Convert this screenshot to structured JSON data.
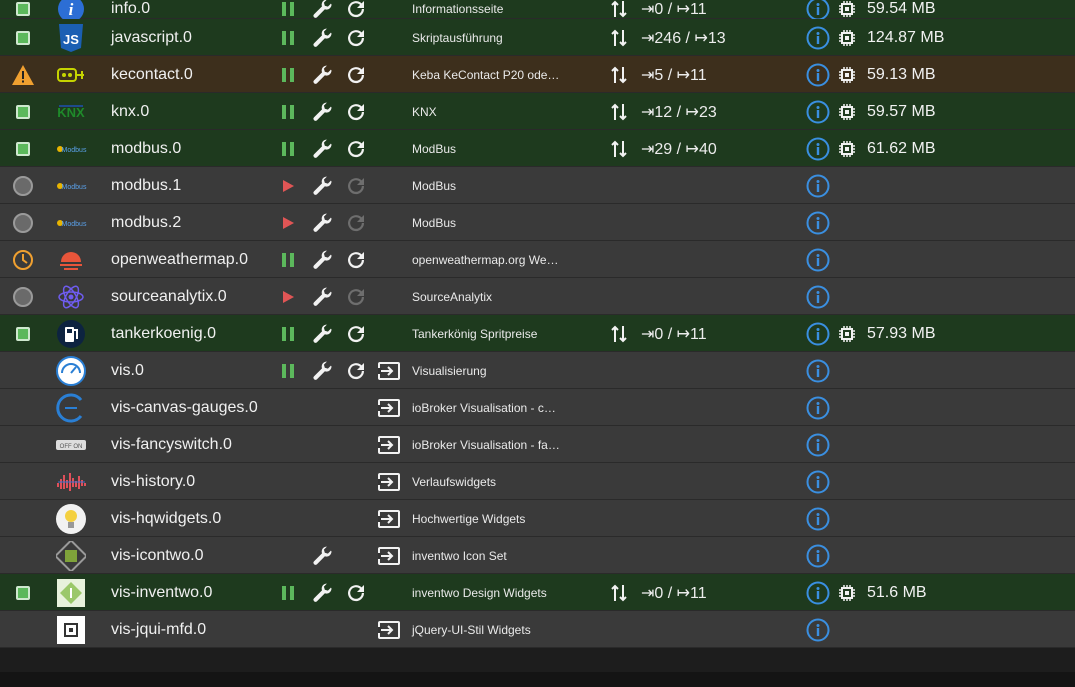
{
  "colors": {
    "running_row": "#1e3a1e",
    "warning_row": "#3d2f1c",
    "stopped_row": "#3a3a3a",
    "status_green": "#5cb85c",
    "run_green": "#5cb85c",
    "play_red": "#e05555",
    "info_blue": "#3a8fe0",
    "warning_orange": "#f0a030"
  },
  "adapters": [
    {
      "name": "info.0",
      "title": "Informationsseite",
      "state": "running",
      "status": "green-square",
      "logo": "info-logo-icon",
      "events": "⇥0 / ↦11",
      "memory": "59.54 MB",
      "link": false
    },
    {
      "name": "javascript.0",
      "title": "Skriptausführung",
      "state": "running",
      "status": "green-square",
      "logo": "javascript-logo-icon",
      "logo_text": "JS",
      "events": "⇥246 / ↦13",
      "memory": "124.87 MB",
      "link": false
    },
    {
      "name": "kecontact.0",
      "title": "Keba KeContact P20 ode…",
      "state": "warning",
      "status": "warning-triangle",
      "logo": "kecontact-logo-icon",
      "events": "⇥5 / ↦11",
      "memory": "59.13 MB",
      "link": false
    },
    {
      "name": "knx.0",
      "title": "KNX",
      "state": "running",
      "status": "green-square",
      "logo": "knx-logo-icon",
      "logo_text": "KNX",
      "events": "⇥12 / ↦23",
      "memory": "59.57 MB",
      "link": false
    },
    {
      "name": "modbus.0",
      "title": "ModBus",
      "state": "running",
      "status": "green-square",
      "logo": "modbus-logo-icon",
      "logo_text": "Modbus",
      "events": "⇥29 / ↦40",
      "memory": "61.62 MB",
      "link": false
    },
    {
      "name": "modbus.1",
      "title": "ModBus",
      "state": "stopped",
      "status": "grey-circle",
      "logo": "modbus-logo-icon",
      "logo_text": "Modbus",
      "events": "",
      "memory": "",
      "link": false
    },
    {
      "name": "modbus.2",
      "title": "ModBus",
      "state": "stopped",
      "status": "grey-circle",
      "logo": "modbus-logo-icon",
      "logo_text": "Modbus",
      "events": "",
      "memory": "",
      "link": false
    },
    {
      "name": "openweathermap.0",
      "title": "openweathermap.org We…",
      "state": "scheduled",
      "status": "clock",
      "logo": "openweathermap-logo-icon",
      "events": "",
      "memory": "",
      "link": false
    },
    {
      "name": "sourceanalytix.0",
      "title": "SourceAnalytix",
      "state": "stopped",
      "status": "grey-circle",
      "logo": "sourceanalytix-logo-icon",
      "events": "",
      "memory": "",
      "link": false
    },
    {
      "name": "tankerkoenig.0",
      "title": "Tankerkönig Spritpreise",
      "state": "running",
      "status": "green-square",
      "logo": "tankerkoenig-logo-icon",
      "events": "⇥0 / ↦11",
      "memory": "57.93 MB",
      "link": false
    },
    {
      "name": "vis.0",
      "title": "Visualisierung",
      "state": "none-running",
      "status": "none",
      "logo": "vis-logo-icon",
      "events": "",
      "memory": "",
      "link": true
    },
    {
      "name": "vis-canvas-gauges.0",
      "title": "ioBroker Visualisation - c…",
      "state": "widget",
      "status": "none",
      "logo": "vis-canvas-gauges-logo-icon",
      "events": "",
      "memory": "",
      "link": true
    },
    {
      "name": "vis-fancyswitch.0",
      "title": "ioBroker Visualisation - fa…",
      "state": "widget",
      "status": "none",
      "logo": "vis-fancyswitch-logo-icon",
      "logo_text": "OFF ON",
      "events": "",
      "memory": "",
      "link": true
    },
    {
      "name": "vis-history.0",
      "title": "Verlaufswidgets",
      "state": "widget",
      "status": "none",
      "logo": "vis-history-logo-icon",
      "events": "",
      "memory": "",
      "link": true
    },
    {
      "name": "vis-hqwidgets.0",
      "title": "Hochwertige Widgets",
      "state": "widget",
      "status": "none",
      "logo": "vis-hqwidgets-logo-icon",
      "events": "",
      "memory": "",
      "link": true
    },
    {
      "name": "vis-icontwo.0",
      "title": "inventwo Icon Set",
      "state": "widget-config",
      "status": "none",
      "logo": "vis-icontwo-logo-icon",
      "events": "",
      "memory": "",
      "link": true
    },
    {
      "name": "vis-inventwo.0",
      "title": "inventwo Design Widgets",
      "state": "running",
      "status": "green-square",
      "logo": "vis-inventwo-logo-icon",
      "events": "⇥0 / ↦11",
      "memory": "51.6 MB",
      "link": false
    },
    {
      "name": "vis-jqui-mfd.0",
      "title": "jQuery-UI-Stil Widgets",
      "state": "widget",
      "status": "none",
      "logo": "vis-jqui-mfd-logo-icon",
      "events": "",
      "memory": "",
      "link": true
    }
  ]
}
